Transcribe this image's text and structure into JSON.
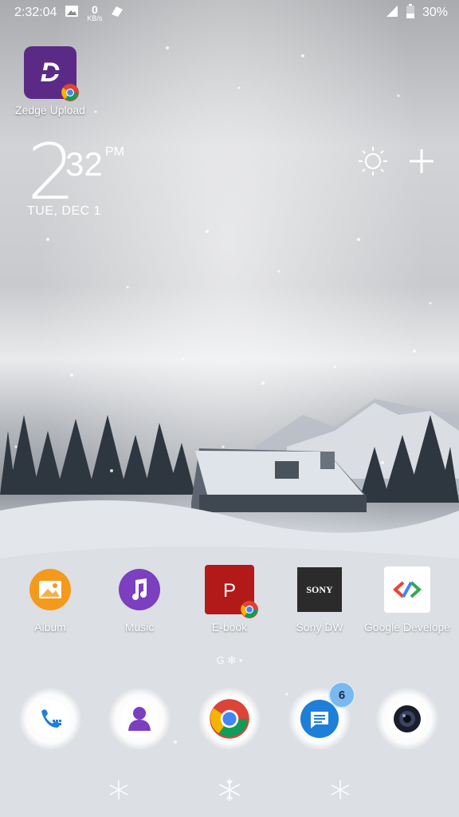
{
  "status_bar": {
    "time": "2:32:04",
    "net_speed_value": "0",
    "net_speed_unit": "KB/s",
    "battery": "30%",
    "icons": [
      "image-icon",
      "data-icon",
      "signal-icon",
      "battery-icon"
    ]
  },
  "widget_app": {
    "label": "Zedge Upload",
    "icon": "zedge-icon"
  },
  "clock": {
    "hour": "2",
    "minutes": "32",
    "ampm": "PM",
    "date": "TUE, DEC 1"
  },
  "weather": {
    "icons": [
      "sun-icon",
      "plus-icon"
    ]
  },
  "apps": [
    {
      "label": "Album",
      "icon": "album-icon",
      "color": "#f39a1c"
    },
    {
      "label": "Music",
      "icon": "music-icon",
      "color": "#7b3fbf"
    },
    {
      "label": "E-book",
      "icon": "ebook-icon",
      "color": "#b21a1a"
    },
    {
      "label": "Sony DW",
      "icon": "sony-icon",
      "color": "#2b2b2b"
    },
    {
      "label": "Google Develope",
      "icon": "google-developers-icon",
      "color": "#ffffff"
    }
  ],
  "dock": [
    {
      "icon": "phone-icon"
    },
    {
      "icon": "contacts-icon"
    },
    {
      "icon": "chrome-icon"
    },
    {
      "icon": "messages-icon",
      "badge": "6"
    },
    {
      "icon": "camera-icon"
    }
  ],
  "pager": {
    "text": "G ✻ •"
  },
  "navigation": {
    "icons": [
      "back-snowflake-icon",
      "home-snowflake-icon",
      "recents-snowflake-icon"
    ]
  }
}
